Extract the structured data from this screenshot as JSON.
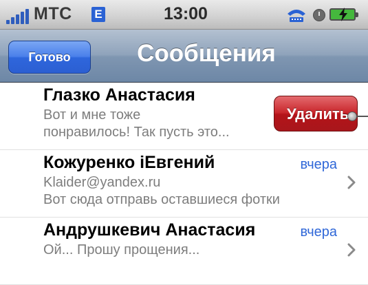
{
  "status_bar": {
    "carrier": "МТС",
    "network": "E",
    "time": "13:00",
    "icons": [
      "signal-icon",
      "tty-icon",
      "alarm-icon",
      "battery-charging-icon"
    ]
  },
  "nav": {
    "done_label": "Готово",
    "title": "Сообщения"
  },
  "messages": [
    {
      "sender": "Глазко Анастасия",
      "line1": "Вот и мне тоже",
      "line2": "понравилось! Так пусть это...",
      "date": "",
      "delete_label": "Удалить"
    },
    {
      "sender": "Кожуренко iЕвгений",
      "line1": "Klaider@yandex.ru",
      "line2": "Вот сюда отправь оставшиеся фотки",
      "date": "вчера"
    },
    {
      "sender": "Андрушкевич Анастасия",
      "line1": "Ой... Прошу прощения...",
      "line2": "",
      "date": "вчера"
    }
  ],
  "colors": {
    "date_blue": "#2f67d8",
    "delete_red": "#c8262b",
    "done_blue": "#2e66dc"
  }
}
